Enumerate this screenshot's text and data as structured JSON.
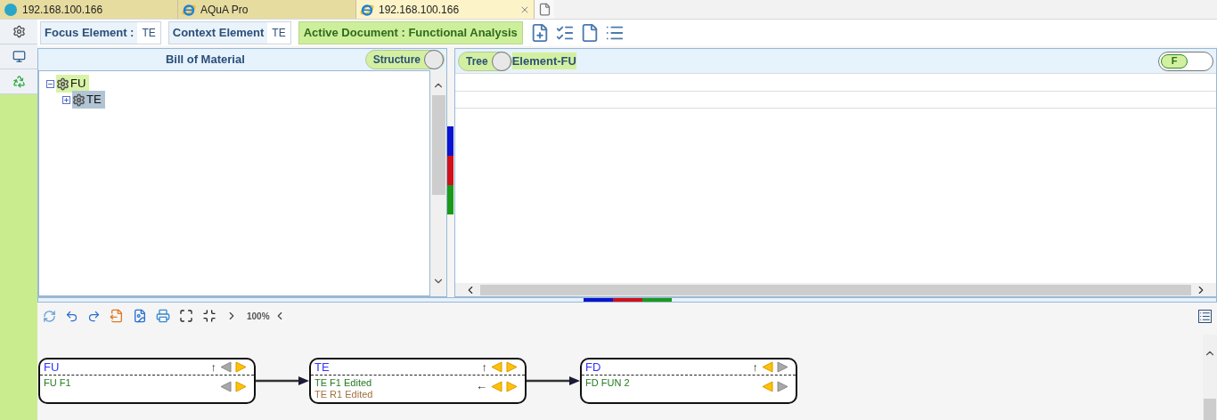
{
  "browser_tabs": [
    {
      "label": "192.168.100.166",
      "kind": "app",
      "selected": false
    },
    {
      "label": "AQuA Pro",
      "kind": "browser",
      "selected": false
    },
    {
      "label": "192.168.100.166",
      "kind": "browser",
      "selected": true
    }
  ],
  "toolbar": {
    "focus_element": {
      "label": "Focus Element :",
      "value": "TE"
    },
    "context_element": {
      "label": "Context Element",
      "value": "TE"
    },
    "active_document": "Active Document : Functional Analysis"
  },
  "bill_of_material": {
    "title": "Bill of Material",
    "toggle": {
      "label": "Structure",
      "on": true
    },
    "tree": [
      {
        "label": "FU",
        "expanded": true,
        "selected": false,
        "children": [
          {
            "label": "TE",
            "expanded": false,
            "selected": true
          }
        ]
      }
    ]
  },
  "element_panel": {
    "toggle": {
      "label": "Tree",
      "on": true
    },
    "title": "Element-FU",
    "filter": {
      "label": "F",
      "on": true
    }
  },
  "diagram": {
    "zoom": "100%",
    "nodes": [
      {
        "title": "FU",
        "header_mark": "↑",
        "header_prev": false,
        "header_next": true,
        "body_prev": false,
        "body_next": true,
        "rows": [
          {
            "text": "FU F1",
            "kind": "function"
          }
        ]
      },
      {
        "title": "TE",
        "header_mark": "↑",
        "header_prev": true,
        "header_next": true,
        "body_mark": "←",
        "body_prev": true,
        "body_next": true,
        "rows": [
          {
            "text": "TE F1 Edited",
            "kind": "function"
          },
          {
            "text": "TE R1 Edited",
            "kind": "requirement"
          }
        ]
      },
      {
        "title": "FD",
        "header_mark": "↑",
        "header_prev": true,
        "header_next": false,
        "body_prev": true,
        "body_next": false,
        "rows": [
          {
            "text": "FD FUN 2",
            "kind": "function"
          }
        ]
      }
    ]
  }
}
